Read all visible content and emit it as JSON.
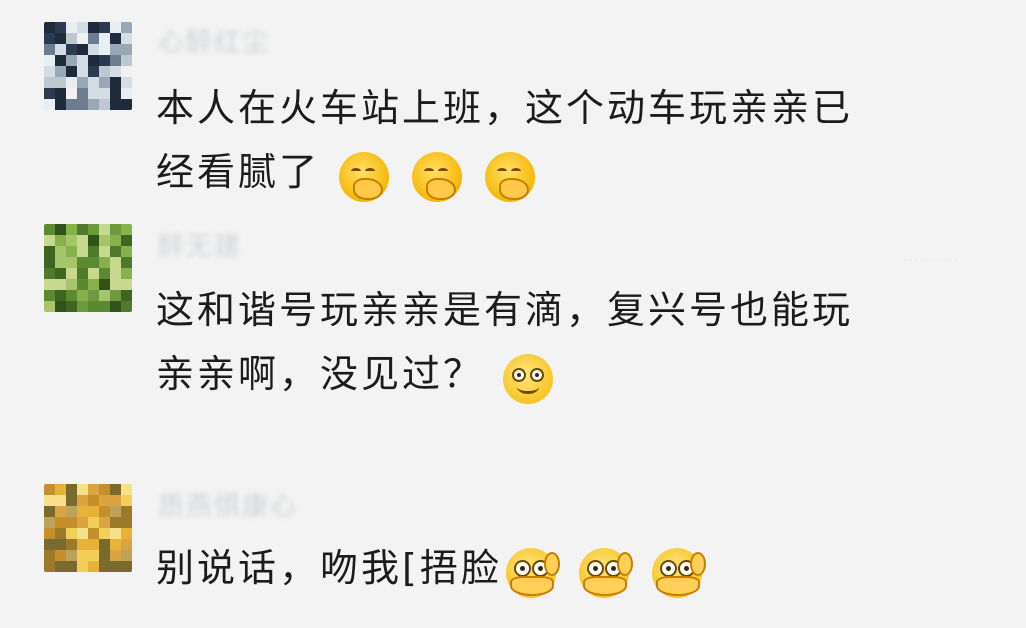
{
  "comments": [
    {
      "name": "心醉红尘",
      "text_line1": "本人在火车站上班，这个动车玩亲亲已",
      "text_line2": "经看腻了",
      "emojis": [
        "hehe-icon",
        "hehe-icon",
        "hehe-icon"
      ]
    },
    {
      "name": "醉无建",
      "text_line1": "这和谐号玩亲亲是有滴，复兴号也能玩",
      "text_line2": "亲亲啊，没见过？",
      "emojis": [
        "smile-icon"
      ]
    },
    {
      "name": "质燕惧康心",
      "text_line1": "别说话，吻我[捂脸",
      "emojis": [
        "cover-face-icon",
        "cover-face-icon",
        "cover-face-icon"
      ]
    }
  ],
  "colors": {
    "background": "#f3f3f3",
    "text": "#1c1c1c",
    "name": "#cfd3d6"
  }
}
